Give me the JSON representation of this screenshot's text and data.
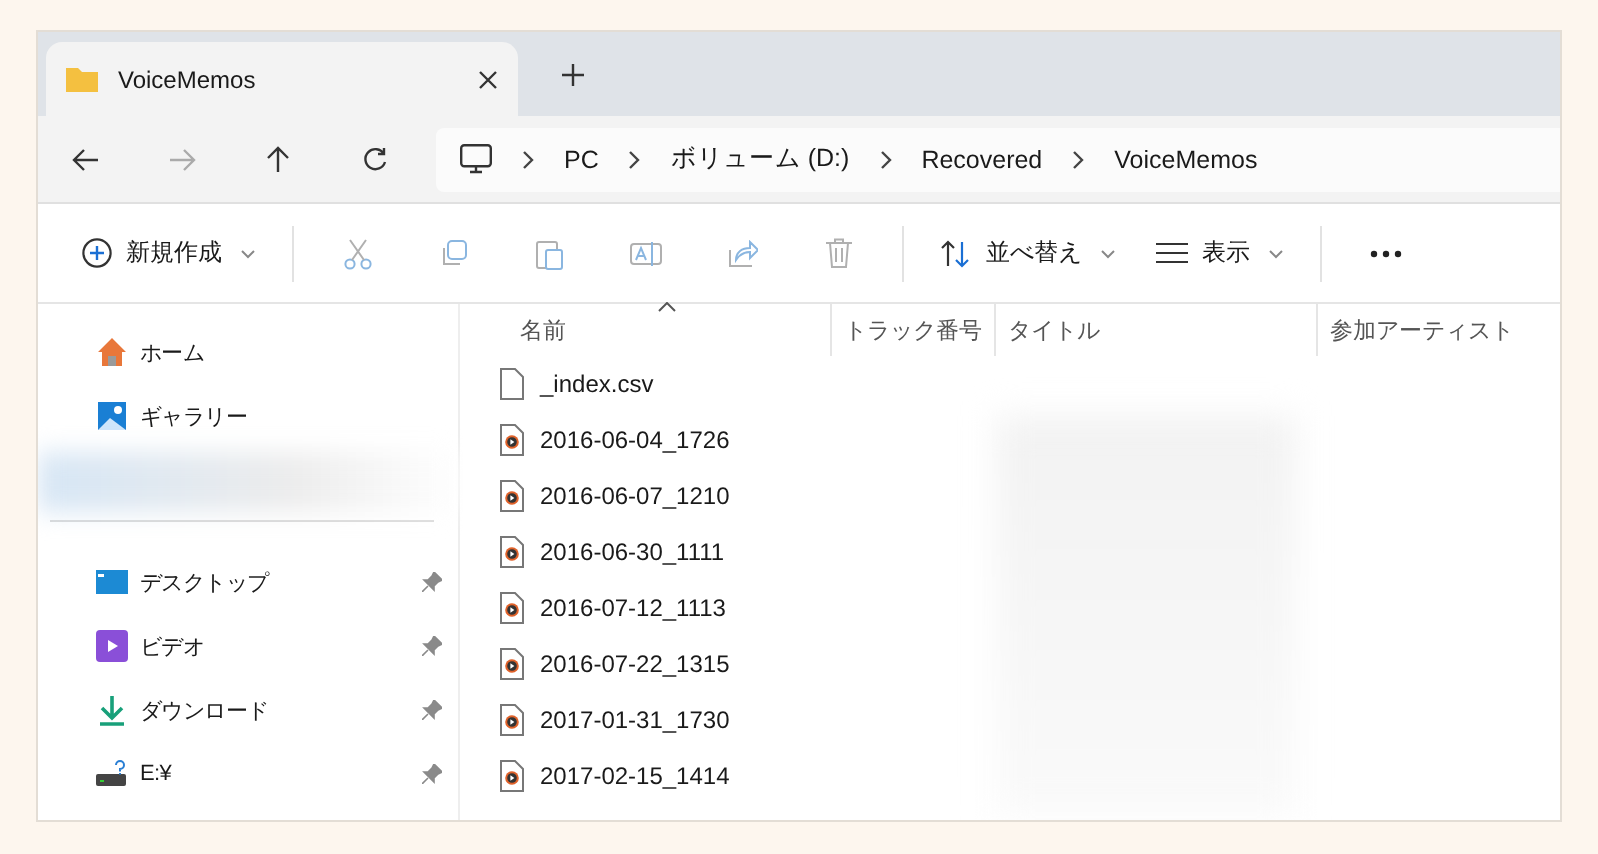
{
  "window": {
    "tab": {
      "title": "VoiceMemos"
    }
  },
  "breadcrumb": [
    "PC",
    "ボリューム (D:)",
    "Recovered",
    "VoiceMemos"
  ],
  "toolbar": {
    "new_label": "新規作成",
    "sort_label": "並べ替え",
    "view_label": "表示"
  },
  "sidebar": {
    "items": [
      {
        "label": "ホーム",
        "kind": "home",
        "pinned": false
      },
      {
        "label": "ギャラリー",
        "kind": "gallery",
        "pinned": false
      }
    ],
    "pinned_items": [
      {
        "label": "デスクトップ",
        "kind": "desktop",
        "pinned": true
      },
      {
        "label": "ビデオ",
        "kind": "video",
        "pinned": true
      },
      {
        "label": "ダウンロード",
        "kind": "download",
        "pinned": true
      },
      {
        "label": "E:¥",
        "kind": "drive",
        "pinned": true
      }
    ]
  },
  "table": {
    "columns": [
      {
        "label": "名前",
        "sorted": true
      },
      {
        "label": "トラック番号",
        "sorted": false
      },
      {
        "label": "タイトル",
        "sorted": false
      },
      {
        "label": "参加アーティスト",
        "sorted": false
      }
    ],
    "rows": [
      {
        "name": "_index.csv",
        "kind": "text"
      },
      {
        "name": "2016-06-04_1726",
        "kind": "audio"
      },
      {
        "name": "2016-06-07_1210",
        "kind": "audio"
      },
      {
        "name": "2016-06-30_1111",
        "kind": "audio"
      },
      {
        "name": "2016-07-12_1113",
        "kind": "audio"
      },
      {
        "name": "2016-07-22_1315",
        "kind": "audio"
      },
      {
        "name": "2017-01-31_1730",
        "kind": "audio"
      },
      {
        "name": "2017-02-15_1414",
        "kind": "audio"
      }
    ]
  }
}
